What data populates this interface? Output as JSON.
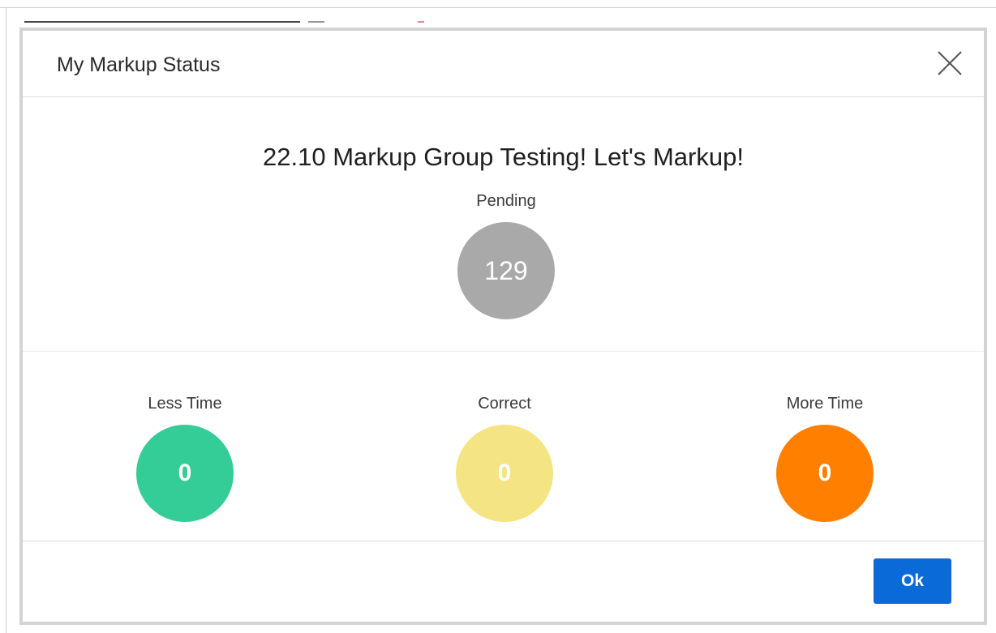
{
  "modal": {
    "title": "My Markup Status",
    "heading": "22.10 Markup Group Testing! Let's Markup!",
    "ok_label": "Ok",
    "close_icon": "close-icon"
  },
  "pending": {
    "label": "Pending",
    "value": "129",
    "color": "#a9a9a9"
  },
  "metrics": [
    {
      "label": "Less Time",
      "value": "0",
      "color": "#34cc97"
    },
    {
      "label": "Correct",
      "value": "0",
      "color": "#f5e483"
    },
    {
      "label": "More Time",
      "value": "0",
      "color": "#ff8000"
    }
  ],
  "colors": {
    "primary_button": "#0a6ad8",
    "modal_border": "#d3d3d3"
  }
}
